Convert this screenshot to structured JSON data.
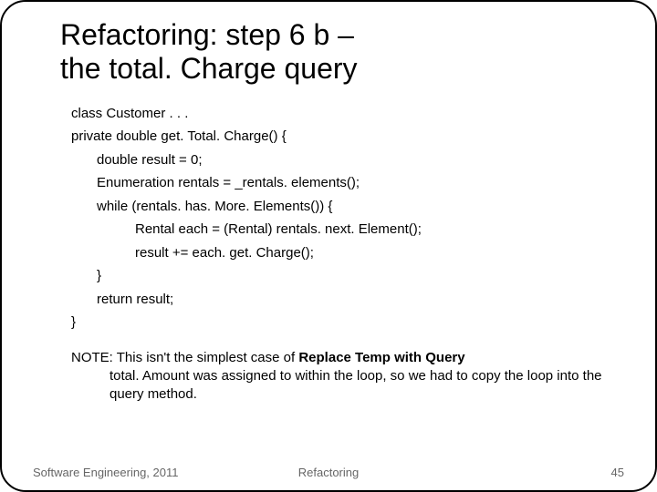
{
  "title_line1": "Refactoring: step 6 b –",
  "title_line2": " the total. Charge query",
  "code": {
    "l1": "class Customer . . .",
    "l2": "private double get. Total. Charge() {",
    "l3": "double result = 0;",
    "l4": "Enumeration rentals = _rentals. elements();",
    "l5": "while (rentals. has. More. Elements()) {",
    "l6": "Rental each = (Rental) rentals. next. Element();",
    "l7": "result += each. get. Charge();",
    "l8": "}",
    "l9": "return result;",
    "l10": "}"
  },
  "note": {
    "prefix": "NOTE: This isn't the simplest case of ",
    "bold": "Replace Temp with Query",
    "body": "total. Amount was assigned to within the loop, so we had to copy the loop into the query method."
  },
  "footer": {
    "left": "Software Engineering, 2011",
    "center": "Refactoring",
    "right": "45"
  }
}
